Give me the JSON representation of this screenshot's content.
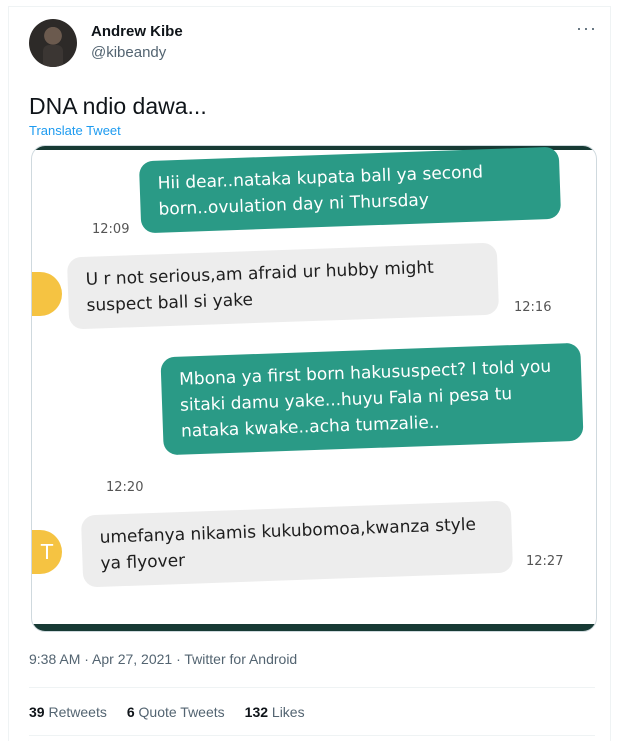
{
  "tweet": {
    "author_name": "Andrew Kibe",
    "author_handle": "@kibeandy",
    "more_label": "···",
    "text": "DNA ndio dawa...",
    "translate_label": "Translate Tweet",
    "timestamp": "9:38 AM · Apr 27, 2021 · Twitter for Android"
  },
  "stats": {
    "retweets_count": "39",
    "retweets_label": "Retweets",
    "quotes_count": "6",
    "quotes_label": "Quote Tweets",
    "likes_count": "132",
    "likes_label": "Likes"
  },
  "chat": {
    "messages": [
      {
        "type": "sent",
        "text": "Hii dear..nataka kupata ball ya second born..ovulation day ni Thursday",
        "time": "12:09"
      },
      {
        "type": "received",
        "text": "U r not serious,am afraid ur hubby might suspect ball si yake",
        "time": "12:16"
      },
      {
        "type": "sent",
        "text": "Mbona ya first born hakususpect? I told you sitaki damu yake...huyu Fala ni pesa tu nataka kwake..acha tumzalie..",
        "time": "12:20"
      },
      {
        "type": "received",
        "text": "umefanya nikamis kukubomoa,kwanza style ya flyover",
        "time": "12:27"
      }
    ],
    "avatar_letter": "T"
  },
  "colors": {
    "accent": "#1d9bf0",
    "sent_bubble": "#2a9a86",
    "received_bubble": "#ededed",
    "avatar_yellow": "#f5c342"
  }
}
